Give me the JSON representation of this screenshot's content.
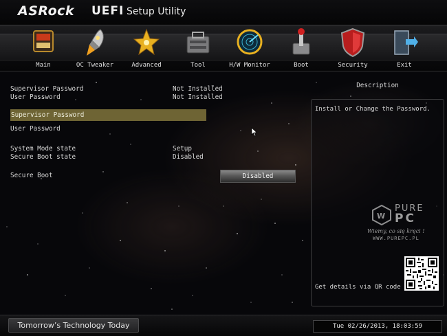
{
  "header": {
    "brand": "ASRock",
    "uefi": "UEFI",
    "subtitle": "Setup Utility"
  },
  "nav": {
    "items": [
      {
        "label": "Main",
        "icon": "main-icon"
      },
      {
        "label": "OC Tweaker",
        "icon": "rocket-icon"
      },
      {
        "label": "Advanced",
        "icon": "star-icon"
      },
      {
        "label": "Tool",
        "icon": "toolbox-icon"
      },
      {
        "label": "H/W Monitor",
        "icon": "radar-icon"
      },
      {
        "label": "Boot",
        "icon": "power-switch-icon"
      },
      {
        "label": "Security",
        "icon": "shield-icon"
      },
      {
        "label": "Exit",
        "icon": "exit-door-icon"
      }
    ]
  },
  "main": {
    "supervisor_password_label": "Supervisor Password",
    "supervisor_password_value": "Not Installed",
    "user_password_label": "User Password",
    "user_password_value": "Not Installed",
    "selected_item": "Supervisor Password",
    "user_password_item": "User Password",
    "system_mode_label": "System Mode state",
    "system_mode_value": "Setup",
    "secure_boot_state_label": "Secure Boot state",
    "secure_boot_state_value": "Disabled",
    "secure_boot_label": "Secure Boot",
    "secure_boot_value": "Disabled"
  },
  "description": {
    "title": "Description",
    "text": "Install or Change the Password.",
    "qr_text": "Get details via QR code"
  },
  "watermark": {
    "pure": "PURE",
    "pc": "PC",
    "slogan": "Wiemy, co się kręci !",
    "url": "WWW.PUREPC.PL"
  },
  "footer": {
    "tagline": "Tomorrow’s Technology Today",
    "datetime": "Tue 02/26/2013, 18:03:59"
  },
  "colors": {
    "selection": "#6e6434",
    "background": "#07070a",
    "accent_red": "#b81e1e"
  }
}
